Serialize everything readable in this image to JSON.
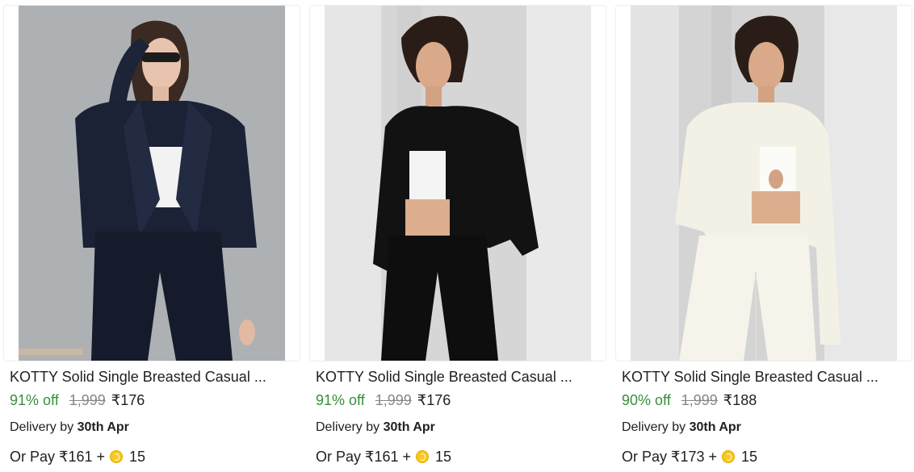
{
  "products": [
    {
      "title": "KOTTY Solid Single Breasted Casual ...",
      "discount": "91% off",
      "mrp": "1,999",
      "price": "₹176",
      "delivery_prefix": "Delivery by",
      "delivery_date": "30th Apr",
      "pay_prefix": "Or Pay ₹161 +",
      "coins": "15",
      "image": "model-navy-blazer"
    },
    {
      "title": "KOTTY Solid Single Breasted Casual ...",
      "discount": "91% off",
      "mrp": "1,999",
      "price": "₹176",
      "delivery_prefix": "Delivery by",
      "delivery_date": "30th Apr",
      "pay_prefix": "Or Pay ₹161 +",
      "coins": "15",
      "image": "model-black-blazer"
    },
    {
      "title": "KOTTY Solid Single Breasted Casual ...",
      "discount": "90% off",
      "mrp": "1,999",
      "price": "₹188",
      "delivery_prefix": "Delivery by",
      "delivery_date": "30th Apr",
      "pay_prefix": "Or Pay ₹173 +",
      "coins": "15",
      "image": "model-white-blazer"
    }
  ],
  "colors": {
    "discount": "#388e3c",
    "mrp": "#878787",
    "text": "#212121",
    "coin": "#f7c81e"
  }
}
